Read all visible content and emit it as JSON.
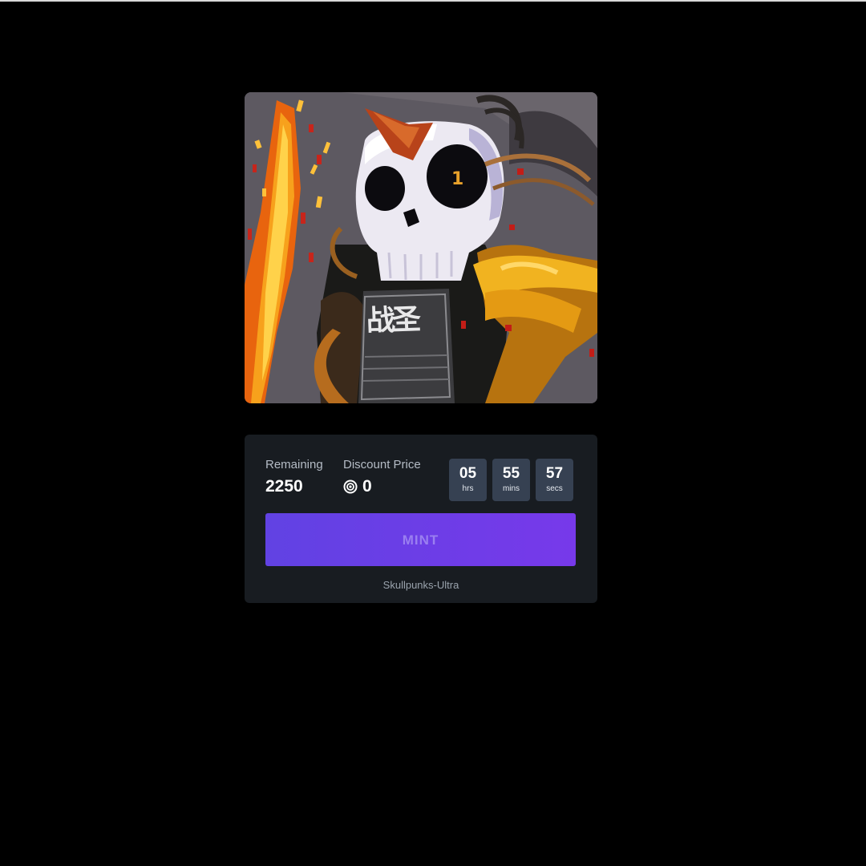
{
  "artwork": {
    "glyphs": "战圣",
    "eye_mark": "1"
  },
  "stats": {
    "remaining_label": "Remaining",
    "remaining_value": "2250",
    "price_label": "Discount Price",
    "price_value": "0",
    "price_icon": "coin-icon"
  },
  "countdown": [
    {
      "value": "05",
      "unit": "hrs"
    },
    {
      "value": "55",
      "unit": "mins"
    },
    {
      "value": "57",
      "unit": "secs"
    }
  ],
  "mint_label": "MINT",
  "collection_name": "Skullpunks-Ultra",
  "colors": {
    "background": "#000000",
    "panel": "#181c21",
    "timer_box": "#364152",
    "button_start": "#6142e3",
    "button_end": "#7739ea"
  }
}
